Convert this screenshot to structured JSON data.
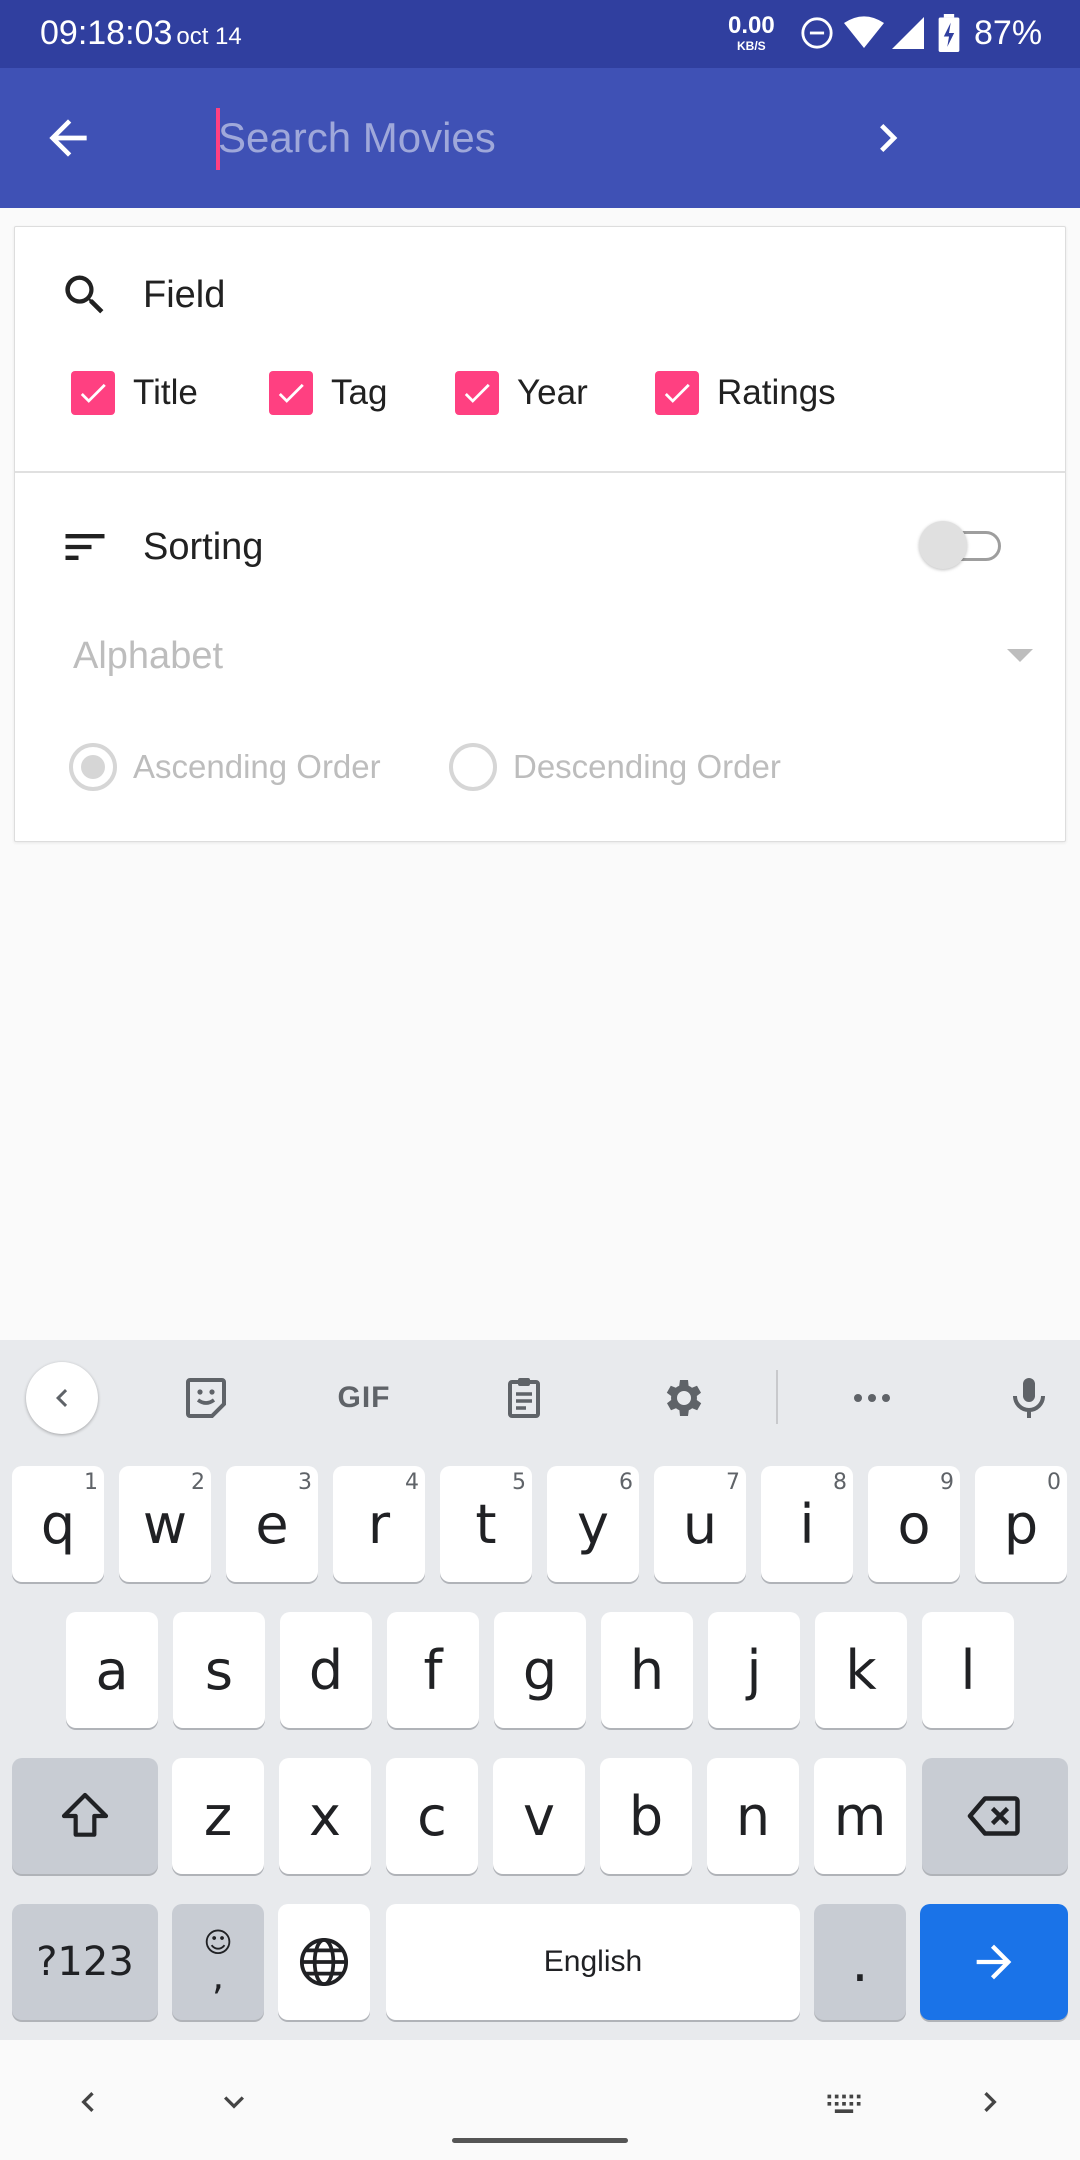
{
  "status_bar": {
    "time": "09:18:03",
    "date": "oct 14",
    "speed_value": "0.00",
    "speed_unit": "KB/S",
    "battery": "87%"
  },
  "app_bar": {
    "search_placeholder": "Search Movies",
    "search_value": "",
    "back_icon": "arrow-left-icon",
    "next_icon": "chevron-right-icon"
  },
  "filter_card": {
    "field_label": "Field",
    "field_options": [
      {
        "label": "Title",
        "checked": true
      },
      {
        "label": "Tag",
        "checked": true
      },
      {
        "label": "Year",
        "checked": true
      },
      {
        "label": "Ratings",
        "checked": true
      }
    ],
    "sorting_label": "Sorting",
    "sorting_enabled": false,
    "sort_by": "Alphabet",
    "order_options": [
      {
        "label": "Ascending Order",
        "selected": true
      },
      {
        "label": "Descending Order",
        "selected": false
      }
    ]
  },
  "keyboard": {
    "toolbar": [
      "chevron-left-icon",
      "sticker-icon",
      "GIF",
      "clipboard-icon",
      "gear-icon",
      "more-icon",
      "mic-icon"
    ],
    "gif_label": "GIF",
    "row1": [
      {
        "k": "q",
        "h": "1"
      },
      {
        "k": "w",
        "h": "2"
      },
      {
        "k": "e",
        "h": "3"
      },
      {
        "k": "r",
        "h": "4"
      },
      {
        "k": "t",
        "h": "5"
      },
      {
        "k": "y",
        "h": "6"
      },
      {
        "k": "u",
        "h": "7"
      },
      {
        "k": "i",
        "h": "8"
      },
      {
        "k": "o",
        "h": "9"
      },
      {
        "k": "p",
        "h": "0"
      }
    ],
    "row2": [
      "a",
      "s",
      "d",
      "f",
      "g",
      "h",
      "j",
      "k",
      "l"
    ],
    "row3": [
      "z",
      "x",
      "c",
      "v",
      "b",
      "n",
      "m"
    ],
    "symbols_label": "?123",
    "emoji_top": "☺",
    "comma": ",",
    "space_label": "English",
    "period": "."
  },
  "colors": {
    "status_bar": "#303f9f",
    "app_bar": "#3f51b5",
    "accent": "#ff4081",
    "enter_key": "#1a73e8"
  }
}
